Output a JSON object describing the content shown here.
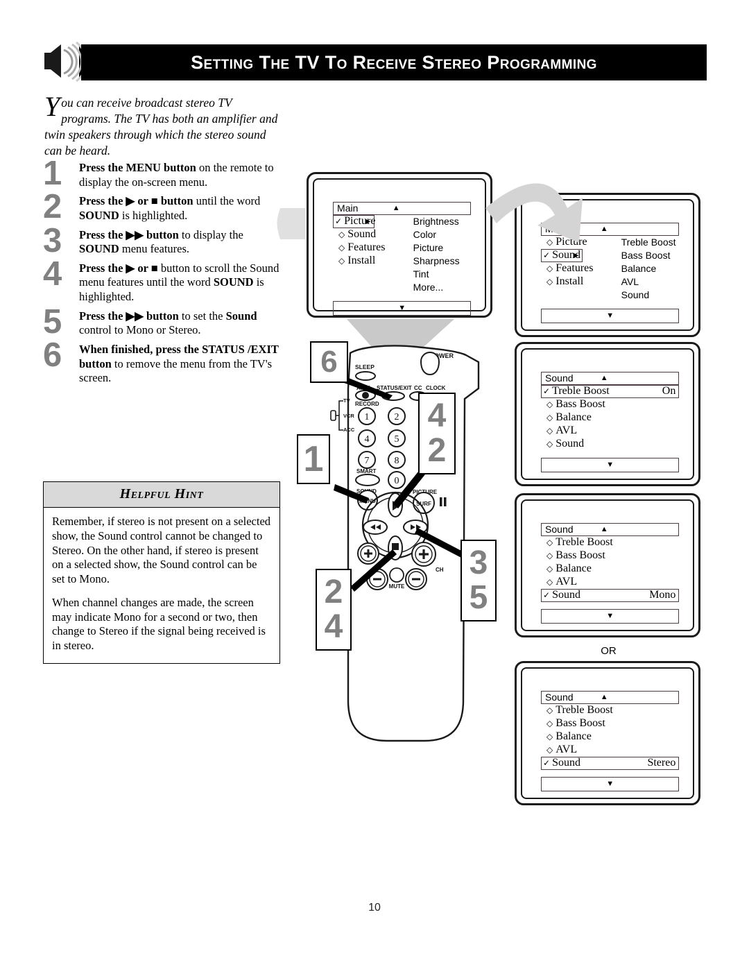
{
  "header": {
    "title": "Setting the TV to Receive Stereo Programming",
    "icon": "speaker-sound-icon"
  },
  "intro": {
    "dropcap": "Y",
    "text": "ou can receive broadcast stereo TV programs. The TV has both an amplifier and twin speakers through which the stereo sound can be heard."
  },
  "steps": [
    {
      "num": "1",
      "html": "<b>Press the MENU button</b> on the remote to display the on-screen menu."
    },
    {
      "num": "2",
      "html": "<b>Press the ▶ or ■ button</b> until the word <b>SOUND</b> is highlighted."
    },
    {
      "num": "3",
      "html": "<b>Press the ▶▶ button</b> to display the <b>SOUND</b> menu features."
    },
    {
      "num": "4",
      "html": "<b>Press the ▶ or ■</b> button to scroll the Sound menu features until the word <b>SOUND</b> is highlighted."
    },
    {
      "num": "5",
      "html": "<b>Press the ▶▶ button</b> to set the <b>Sound</b> control to Mono or Stereo."
    },
    {
      "num": "6",
      "html": "<b>When finished, press the STATUS /EXIT button</b> to remove the menu from the TV's screen."
    }
  ],
  "hint": {
    "heading": "Helpful Hint",
    "paragraphs": [
      "Remember, if stereo is not present on a selected show, the Sound control cannot be changed to Stereo. On the other hand, if stereo is present on a selected show, the Sound control can be set to Mono.",
      "When channel changes are made, the screen may indicate Mono for a second or two, then change to Stereo if the signal being received is in stereo."
    ]
  },
  "or_label": "OR",
  "page_number": "10",
  "tv_screens": [
    {
      "id": "main-picture",
      "title": "Main",
      "up_arrow": "▲",
      "down_arrow": "▼",
      "left_items": [
        {
          "label": "Picture",
          "selected": true,
          "marker": "✓",
          "arrow": "▶"
        },
        {
          "label": "Sound",
          "selected": false,
          "marker": "◇"
        },
        {
          "label": "Features",
          "selected": false,
          "marker": "◇"
        },
        {
          "label": "Install",
          "selected": false,
          "marker": "◇"
        }
      ],
      "right_items": [
        "Brightness",
        "Color",
        "Picture",
        "Sharpness",
        "Tint",
        "More..."
      ]
    },
    {
      "id": "main-sound",
      "title": "Main",
      "up_arrow": "▲",
      "down_arrow": "▼",
      "left_items": [
        {
          "label": "Picture",
          "selected": false,
          "marker": "◇"
        },
        {
          "label": "Sound",
          "selected": true,
          "marker": "✓",
          "arrow": "▶"
        },
        {
          "label": "Features",
          "selected": false,
          "marker": "◇"
        },
        {
          "label": "Install",
          "selected": false,
          "marker": "◇"
        }
      ],
      "right_items": [
        "Treble Boost",
        "Bass Boost",
        "Balance",
        "AVL",
        "Sound"
      ]
    },
    {
      "id": "sound-treble-on",
      "title": "Sound",
      "up_arrow": "▲",
      "down_arrow": "▼",
      "rows": [
        {
          "label": "Treble Boost",
          "selected": true,
          "marker": "✓",
          "value": "On"
        },
        {
          "label": "Bass Boost",
          "selected": false,
          "marker": "◇",
          "value": ""
        },
        {
          "label": "Balance",
          "selected": false,
          "marker": "◇",
          "value": ""
        },
        {
          "label": "AVL",
          "selected": false,
          "marker": "◇",
          "value": ""
        },
        {
          "label": "Sound",
          "selected": false,
          "marker": "◇",
          "value": ""
        }
      ]
    },
    {
      "id": "sound-mono",
      "title": "Sound",
      "up_arrow": "▲",
      "down_arrow": "▼",
      "rows": [
        {
          "label": "Treble Boost",
          "selected": false,
          "marker": "◇",
          "value": ""
        },
        {
          "label": "Bass Boost",
          "selected": false,
          "marker": "◇",
          "value": ""
        },
        {
          "label": "Balance",
          "selected": false,
          "marker": "◇",
          "value": ""
        },
        {
          "label": "AVL",
          "selected": false,
          "marker": "◇",
          "value": ""
        },
        {
          "label": "Sound",
          "selected": true,
          "marker": "✓",
          "value": "Mono"
        }
      ]
    },
    {
      "id": "sound-stereo",
      "title": "Sound",
      "up_arrow": "▲",
      "down_arrow": "▼",
      "rows": [
        {
          "label": "Treble Boost",
          "selected": false,
          "marker": "◇",
          "value": ""
        },
        {
          "label": "Bass Boost",
          "selected": false,
          "marker": "◇",
          "value": ""
        },
        {
          "label": "Balance",
          "selected": false,
          "marker": "◇",
          "value": ""
        },
        {
          "label": "AVL",
          "selected": false,
          "marker": "◇",
          "value": ""
        },
        {
          "label": "Sound",
          "selected": true,
          "marker": "✓",
          "value": "Stereo"
        }
      ]
    }
  ],
  "remote": {
    "labels": {
      "sleep": "SLEEP",
      "power": "POWER",
      "a_ch": "A.CH",
      "status_exit": "STATUS/EXIT",
      "cc": "CC",
      "clock": "CLOCK",
      "record": "RECORD",
      "tv": "TV",
      "vcr": "VCR",
      "acc": "ACC",
      "smart": "SMART",
      "sound": "SOUND",
      "menu": "MENU",
      "picture": "PICTURE",
      "surf": "SURF",
      "mute": "MUTE",
      "ch": "CH"
    },
    "keypad": [
      "1",
      "2",
      "4",
      "5",
      "7",
      "8",
      "0"
    ]
  },
  "callouts": [
    {
      "id": "callout-6",
      "num": "6"
    },
    {
      "id": "callout-1",
      "num": "1"
    },
    {
      "id": "callout-4-2",
      "nums": [
        "4",
        "2"
      ]
    },
    {
      "id": "callout-2-4",
      "nums": [
        "2",
        "4"
      ]
    },
    {
      "id": "callout-3-5",
      "nums": [
        "3",
        "5"
      ]
    }
  ],
  "colors": {
    "accent_gray": "#808080",
    "band_black": "#000000",
    "hint_header": "#d9d9d9",
    "osd_border": "#4a3a43"
  }
}
